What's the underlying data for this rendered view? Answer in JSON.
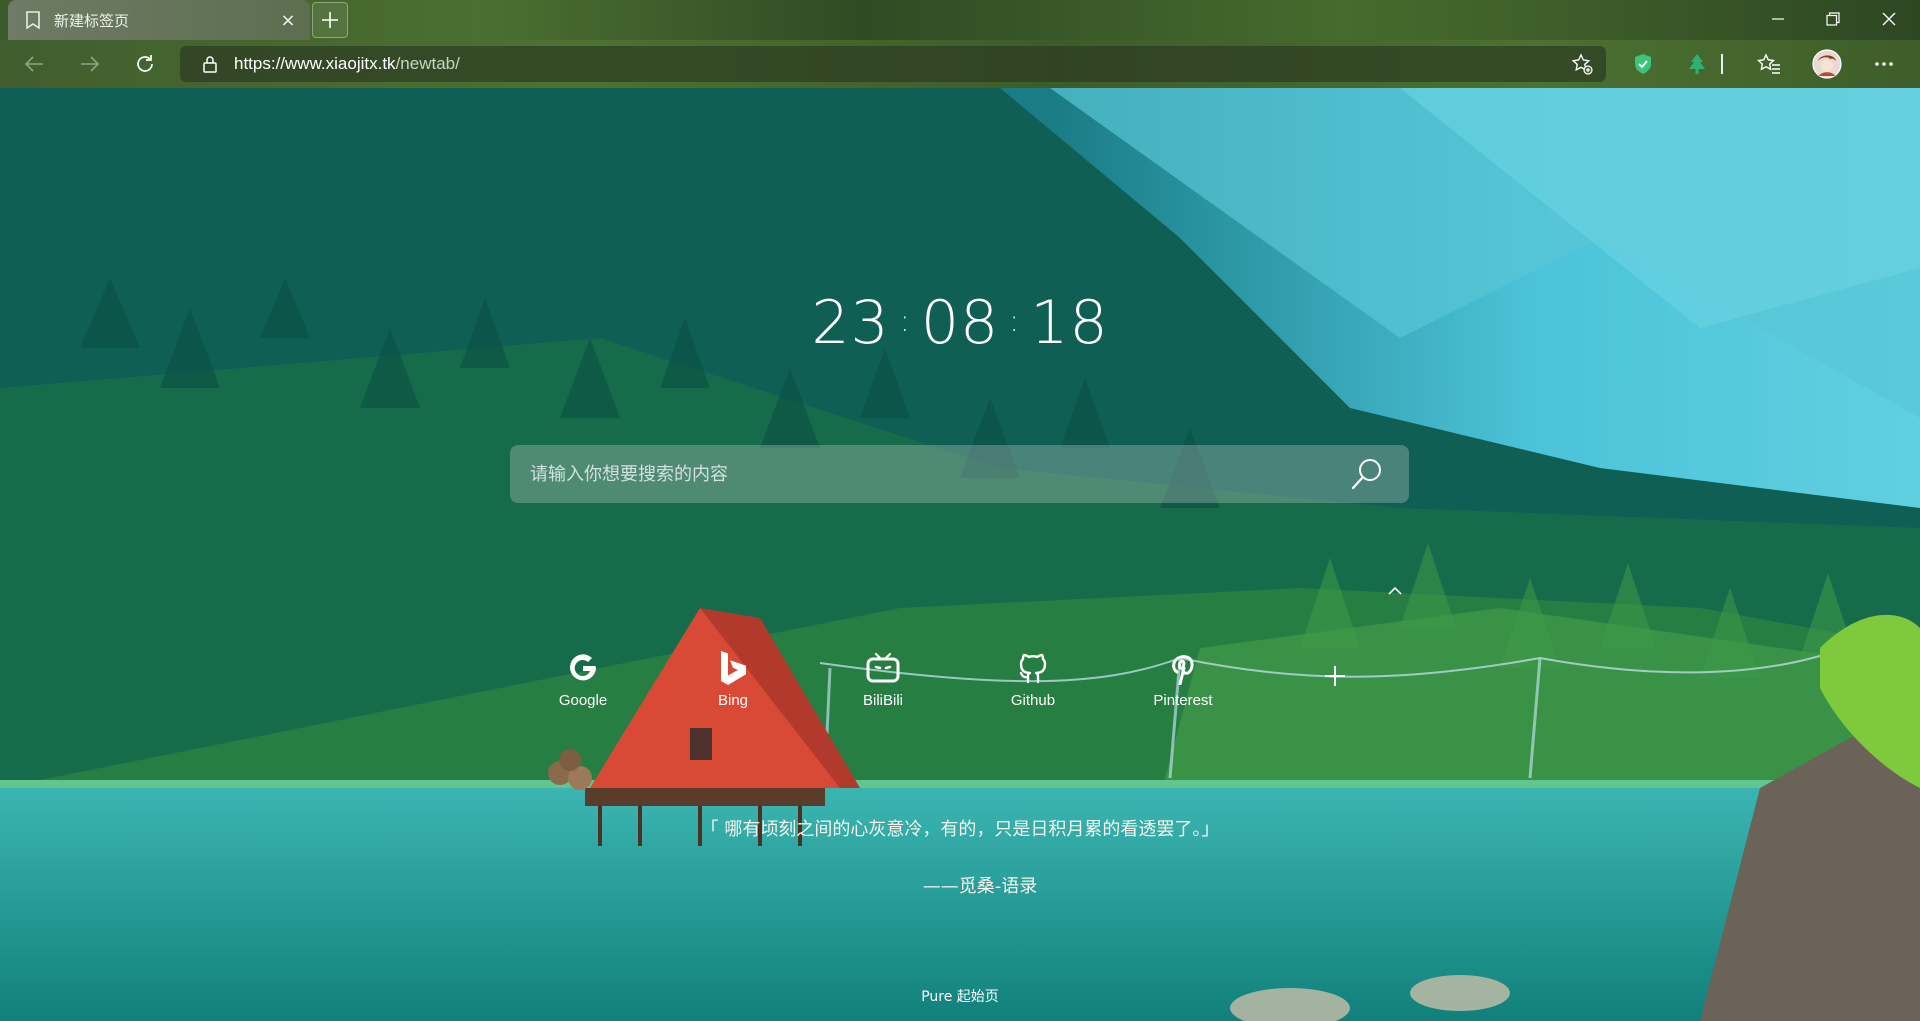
{
  "browser": {
    "tab": {
      "title": "新建标签页",
      "close_glyph": "×",
      "icon": "bookmark-icon"
    },
    "new_tab_glyph": "+",
    "window_controls": {
      "minimize": "─",
      "maximize": "❐",
      "close": "✕"
    },
    "address": {
      "url_host": "https://www.xiaojitx.tk",
      "url_path": "/newtab/"
    },
    "toolbar_icons": [
      "back-icon",
      "forward-icon",
      "refresh-icon",
      "lock-icon",
      "add-favorite-icon",
      "shield-extension-icon",
      "tree-extension-icon",
      "favorites-icon",
      "profile-avatar",
      "more-icon"
    ],
    "colors": {
      "chrome": "#4b6f31",
      "shield": "#3cc47a",
      "tree": "#2fb073"
    }
  },
  "page": {
    "clock": {
      "hours": "23",
      "minutes": "08",
      "seconds": "18",
      "separator": ":"
    },
    "search": {
      "placeholder": "请输入你想要搜索的内容",
      "value": ""
    },
    "shortcuts": [
      {
        "label": "Google",
        "icon": "google-icon"
      },
      {
        "label": "Bing",
        "icon": "bing-icon"
      },
      {
        "label": "BiliBili",
        "icon": "bilibili-icon"
      },
      {
        "label": "Github",
        "icon": "github-icon"
      },
      {
        "label": "Pinterest",
        "icon": "pinterest-icon"
      }
    ],
    "add_shortcut_glyph": "+",
    "quote": {
      "text": "「 哪有顷刻之间的心灰意冷，有的，只是日积月累的看透罢了。」",
      "source": "——觅桑-语录"
    },
    "footer": "Pure 起始页"
  }
}
